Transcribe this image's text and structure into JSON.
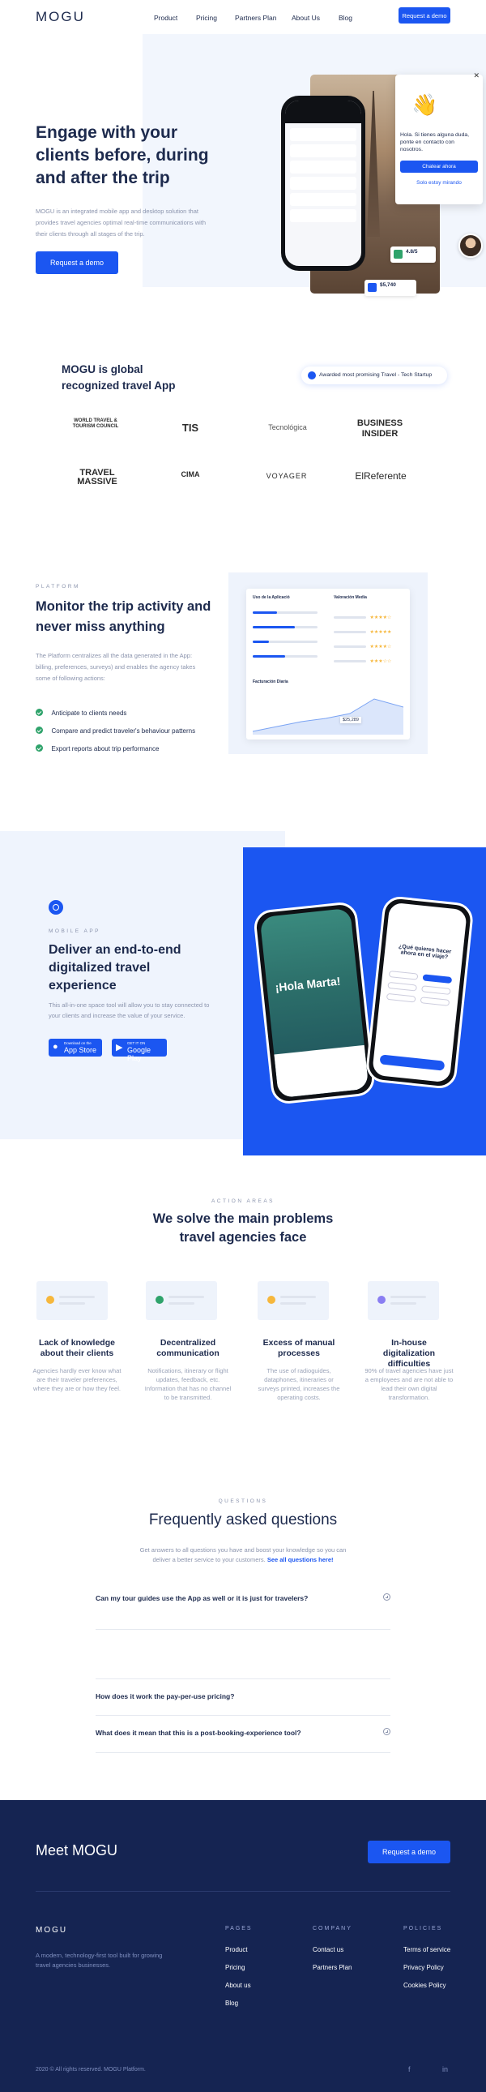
{
  "nav": {
    "logo": "MOGU",
    "links": [
      "Product",
      "Pricing",
      "Partners Plan",
      "About Us",
      "Blog"
    ],
    "cta": "Request a demo"
  },
  "hero": {
    "title": "Engage with your clients before, during and after the trip",
    "body": "MOGU is an integrated mobile app and desktop solution that provides travel agencies optimal real-time communications with their clients through all stages of the trip.",
    "cta": "Request a demo",
    "chat": {
      "text": "Hola. Si tienes alguna duda, ponte en contacto con nosotros.",
      "primary": "Chatear ahora",
      "secondary": "Solo estoy mirando"
    },
    "stat1_value": "4.8/5",
    "stat2_value": "$5,740"
  },
  "global": {
    "title": "MOGU is global recognized travel App",
    "badge": "Awarded most promising Travel - Tech Startup",
    "logos": [
      "WORLD TRAVEL & TOURISM COUNCIL",
      "TIS",
      "Tecnológica",
      "BUSINESS INSIDER",
      "TRAVEL MASSIVE",
      "CIMA",
      "VOYAGER",
      "ElReferente"
    ]
  },
  "platform": {
    "eyebrow": "PLATFORM",
    "title": "Monitor the trip activity and never miss anything",
    "body": "The Platform centralizes all the data generated in the App: billing, preferences, surveys) and enables the agency takes some of following actions:",
    "items": [
      "Anticipate to clients needs",
      "Compare and predict traveler's behaviour patterns",
      "Export reports about trip performance"
    ],
    "dash": {
      "left_head": "Uso de la Aplicació",
      "right_head": "Valoración Media",
      "chart_head": "Facturación Diaria",
      "chart_value": "$25,289"
    }
  },
  "mobile": {
    "eyebrow": "MOBILE APP",
    "title": "Deliver an end-to-end digitalized travel experience",
    "body": "This all-in-one space tool will allow you to stay connected to your clients and increase the value of your service.",
    "appstore_small": "Download on the",
    "appstore": "App Store",
    "play_small": "GET IT ON",
    "play": "Google Play",
    "phone1_title": "¡Hola Marta!",
    "phone2_title": "¿Qué quieres hacer ahora en el viaje?"
  },
  "problems": {
    "eyebrow": "ACTION AREAS",
    "title": "We solve the main problems travel agencies face",
    "cards": [
      {
        "title": "Lack of knowledge about their clients",
        "text": "Agencies hardly ever know what are their traveler preferences, where they are or how they feel."
      },
      {
        "title": "Decentralized communication",
        "text": "Notifications, itinerary or flight updates, feedback, etc. Information that has no channel to be transmitted."
      },
      {
        "title": "Excess of manual processes",
        "text": "The use of radioguides, dataphones, itineraries or surveys printed, increases the operating costs."
      },
      {
        "title": "In-house digitalization difficulties",
        "text": "90% of travel agencies have just a employees and are not able to lead their own digital transformation."
      }
    ]
  },
  "faq": {
    "eyebrow": "QUESTIONS",
    "title": "Frequently asked questions",
    "intro": "Get answers to all questions you have and boost your knowledge so you can deliver a better service to your customers.",
    "intro_link": "See all questions here!",
    "questions": [
      "Can my tour guides use the App as well or it is just for travelers?",
      "How does it work the pay-per-use pricing?",
      "What does it mean that this is a post-booking-experience tool?"
    ]
  },
  "footer": {
    "title": "Meet MOGU",
    "cta": "Request a demo",
    "logo": "MOGU",
    "tagline": "A modern, technology-first tool built for growing travel agencies businesses.",
    "pages_head": "PAGES",
    "pages": [
      "Product",
      "Pricing",
      "About us",
      "Blog"
    ],
    "company_head": "COMPANY",
    "company": [
      "Contact us",
      "Partners Plan"
    ],
    "policies_head": "POLICIES",
    "policies": [
      "Terms of service",
      "Privacy Policy",
      "Cookies Policy"
    ],
    "copyright": "2020 © All rights reserved. MOGU Platform.",
    "social": [
      "f",
      "in"
    ]
  },
  "colors": {
    "accent": "#1b56f1",
    "navy": "#152452",
    "panel": "#eff4fd"
  }
}
